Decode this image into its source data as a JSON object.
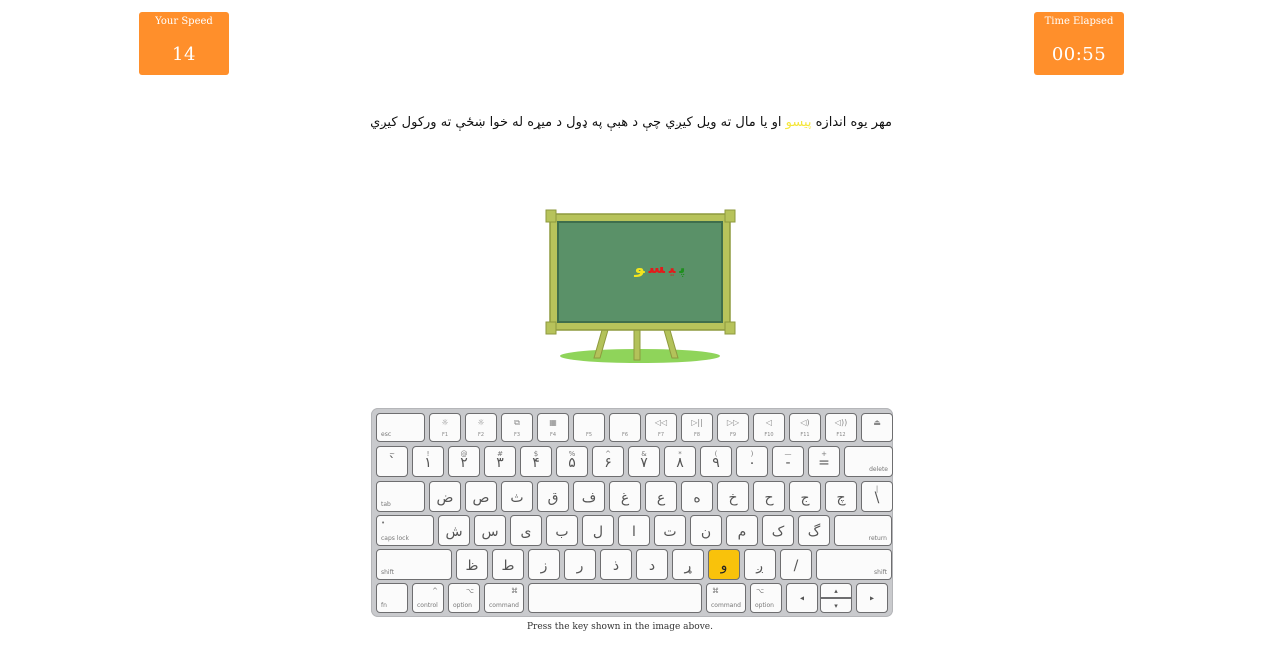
{
  "stats": {
    "speed": {
      "label": "Your Speed",
      "value": "14"
    },
    "time": {
      "label": "Time Elapsed",
      "value": "00:55"
    }
  },
  "sentence": {
    "before": "مهر یوه اندازه ",
    "highlight": "پیسو",
    "after": " او یا مال ته ویل کیږي چې د هبې په ډول د میړه له خوا ښځې ته ورکول کیږي",
    "highlight_color": "#f5e63c"
  },
  "board": {
    "letters": [
      {
        "char": "پ",
        "color": "#1f8f1f"
      },
      {
        "char": "ی",
        "color": "#e21b1b"
      },
      {
        "char": "س",
        "color": "#e21b1b"
      },
      {
        "char": "و",
        "color": "#f2e51e"
      }
    ]
  },
  "keyboard": {
    "active_color": "#f9c20b",
    "fn_row": [
      {
        "label": "esc"
      },
      {
        "glyph": "☼",
        "label": "F1"
      },
      {
        "glyph": "☼",
        "label": "F2"
      },
      {
        "glyph": "⧉",
        "label": "F3"
      },
      {
        "glyph": "▦",
        "label": "F4"
      },
      {
        "glyph": "",
        "label": "F5"
      },
      {
        "glyph": "",
        "label": "F6"
      },
      {
        "glyph": "◁◁",
        "label": "F7"
      },
      {
        "glyph": "▷||",
        "label": "F8"
      },
      {
        "glyph": "▷▷",
        "label": "F9"
      },
      {
        "glyph": "◁",
        "label": "F10"
      },
      {
        "glyph": "◁)",
        "label": "F11"
      },
      {
        "glyph": "◁))",
        "label": "F12"
      },
      {
        "glyph": "⏏",
        "label": ""
      }
    ],
    "number_row": [
      {
        "top": "~",
        "main": "`"
      },
      {
        "top": "!",
        "main": "۱"
      },
      {
        "top": "@",
        "main": "۲"
      },
      {
        "top": "#",
        "main": "۳"
      },
      {
        "top": "$",
        "main": "۴"
      },
      {
        "top": "%",
        "main": "۵"
      },
      {
        "top": "^",
        "main": "۶"
      },
      {
        "top": "&",
        "main": "۷"
      },
      {
        "top": "*",
        "main": "۸"
      },
      {
        "top": "(",
        "main": "۹"
      },
      {
        "top": ")",
        "main": "٠"
      },
      {
        "top": "—",
        "main": "-"
      },
      {
        "top": "+",
        "main": "="
      },
      {
        "label": "delete"
      }
    ],
    "top_row": [
      {
        "label": "tab"
      },
      {
        "main": "ض"
      },
      {
        "main": "ص"
      },
      {
        "main": "ث"
      },
      {
        "main": "ق"
      },
      {
        "main": "ف"
      },
      {
        "main": "غ"
      },
      {
        "main": "ع"
      },
      {
        "main": "ه"
      },
      {
        "main": "خ"
      },
      {
        "main": "ح"
      },
      {
        "main": "ج"
      },
      {
        "main": "چ"
      },
      {
        "top": "|",
        "main": "\\"
      }
    ],
    "home_row": [
      {
        "label": "caps lock",
        "dot": "•"
      },
      {
        "main": "ش"
      },
      {
        "main": "س"
      },
      {
        "main": "ی"
      },
      {
        "main": "ب"
      },
      {
        "main": "ل"
      },
      {
        "main": "ا"
      },
      {
        "main": "ت"
      },
      {
        "main": "ن"
      },
      {
        "main": "م"
      },
      {
        "main": "ک"
      },
      {
        "main": "گ"
      },
      {
        "label": "return"
      }
    ],
    "bottom_row": [
      {
        "label": "shift"
      },
      {
        "main": "ظ"
      },
      {
        "main": "ط"
      },
      {
        "main": "ز"
      },
      {
        "main": "ر"
      },
      {
        "main": "ذ"
      },
      {
        "main": "د"
      },
      {
        "main": "ړ"
      },
      {
        "main": "و",
        "active": true
      },
      {
        "main": "ږ"
      },
      {
        "main": "/"
      },
      {
        "label": "shift"
      }
    ],
    "mod_row": [
      {
        "label": "fn"
      },
      {
        "glyph": "^",
        "label": "control"
      },
      {
        "glyph": "⌥",
        "label": "option"
      },
      {
        "glyph": "⌘",
        "label": "command"
      },
      {
        "label": ""
      },
      {
        "glyph": "⌘",
        "label": "command"
      },
      {
        "glyph": "⌥",
        "label": "option"
      },
      {
        "glyph": "◂",
        "label": ""
      },
      {
        "glyph": "▴",
        "label": ""
      },
      {
        "glyph": "▾",
        "label": ""
      },
      {
        "glyph": "▸",
        "label": ""
      }
    ]
  },
  "hint": "Press the key shown in the image above."
}
